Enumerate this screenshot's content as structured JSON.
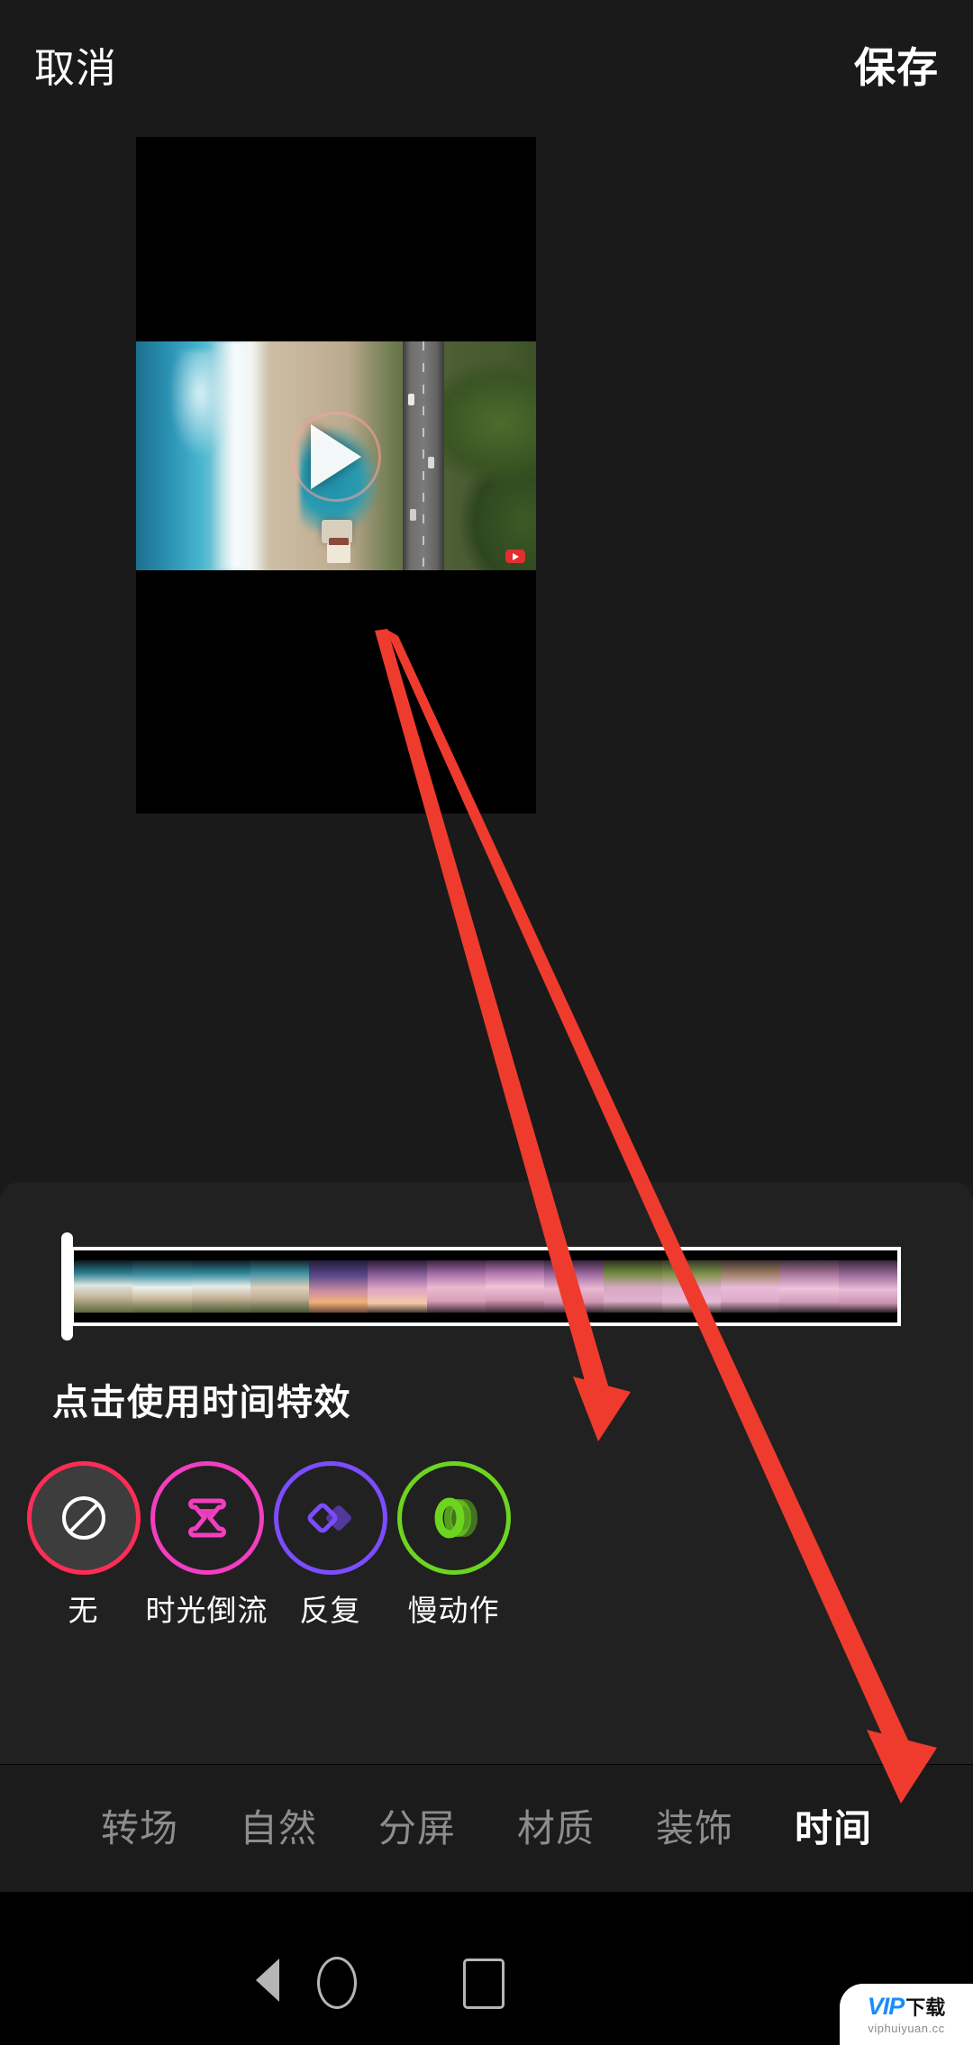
{
  "app": {
    "theme_bg": "#1a1a1a",
    "panel_bg": "#212121",
    "accent_selected": "#ff2d55"
  },
  "topbar": {
    "cancel_label": "取消",
    "save_label": "保存"
  },
  "preview": {
    "play_icon": "play-triangle-icon",
    "blurred_watermark_placeholder": ""
  },
  "timeline": {
    "clip_selected": true,
    "handle_icon": "trim-handle-left"
  },
  "effects_panel": {
    "title": "点击使用时间特效",
    "items": [
      {
        "label": "无",
        "icon": "no-effect-prohibition-icon",
        "ring_color": "#ff2d55",
        "icon_color": "#ffffff",
        "selected": true
      },
      {
        "label": "时光倒流",
        "icon": "hourglass-rewind-icon",
        "ring_color": "#f23ec0",
        "icon_color": "#f23ec0",
        "selected": false
      },
      {
        "label": "反复",
        "icon": "double-diamond-repeat-icon",
        "ring_color": "#7b4dff",
        "icon_color": "#7b4dff",
        "selected": false
      },
      {
        "label": "慢动作",
        "icon": "slow-motion-rings-icon",
        "ring_color": "#6dd420",
        "icon_color": "#6dd420",
        "selected": false
      }
    ]
  },
  "tabbar": {
    "tabs": [
      {
        "label": "转场",
        "active": false
      },
      {
        "label": "自然",
        "active": false
      },
      {
        "label": "分屏",
        "active": false
      },
      {
        "label": "材质",
        "active": false
      },
      {
        "label": "装饰",
        "active": false
      },
      {
        "label": "时间",
        "active": true
      }
    ]
  },
  "navbar": {
    "back_icon": "back-triangle-icon",
    "home_icon": "home-circle-icon",
    "recent_icon": "recent-square-icon"
  },
  "watermark": {
    "vip_text": "VIP",
    "download_text": "下载",
    "site_text": "viphuiyuan.cc"
  },
  "annotations": {
    "arrow_color": "#ef3b2d",
    "arrows": [
      {
        "name": "arrow-to-slow-motion"
      },
      {
        "name": "arrow-to-time-tab"
      }
    ]
  }
}
